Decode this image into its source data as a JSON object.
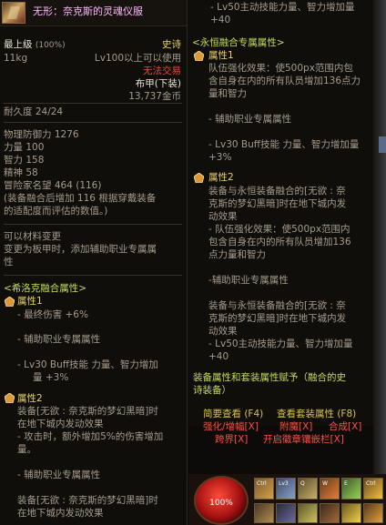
{
  "tooltip": {
    "name": "无形：奈克斯的灵魂仪服",
    "level_label": "最上级",
    "level_pct": "(100%)",
    "rarity": "史诗",
    "weight": "11kg",
    "level_req": "Lv100以上可以使用",
    "trade": "无法交易",
    "type": "布甲(下装)",
    "price": "13,737金币",
    "durability": "耐久度 24/24",
    "stats": [
      "物理防御力 1276",
      "力量 100",
      "智力 158",
      "精神 58",
      "冒险家名望 464 (116)",
      "(装备融合后增加 116 根据穿戴装备",
      "的适配度而评估的数值。)"
    ],
    "transfer": "可以材料变更",
    "transfer_desc": [
      "变更为板甲时，添加辅助职业专属属",
      "性"
    ],
    "fusion_title": "<希洛克融合属性>",
    "attr1_label": "属性1",
    "attr1_lines": [
      "- 最终伤害 +6%",
      "- 辅助职业专属属性",
      "- Lv30 Buff技能 力量、智力增加",
      "量 +3%"
    ],
    "attr2_label": "属性2",
    "attr2_lines": [
      "装备[无欲 : 奈克斯的梦幻黑暗]时",
      "在地下城内发动效果",
      "- 攻击时，额外增加5%的伤害增加",
      "量。",
      "- 辅助职业专属属性",
      "装备[无欲 : 奈克斯的梦幻黑暗]时",
      "在地下城内发动效果"
    ]
  },
  "tooltip_right": {
    "top_lines": [
      "- Lv50主动技能力量、智力增加量",
      "+40"
    ],
    "eternal_title": "<永恒融合专属属性>",
    "attr1_label": "属性1",
    "attr1_lines": [
      "队伍强化效果：使500px范围内包",
      "含自身在内的所有队员增加136点力",
      "量和智力",
      "- 辅助职业专属属性",
      "- Lv30 Buff技能 力量、智力增加量",
      "+3%"
    ],
    "attr2_label": "属性2",
    "attr2_lines": [
      "装备与永恒装备融合的[无欲 : 奈",
      "克斯的梦幻黑暗]时在地下城内发",
      "动效果",
      "- 队伍强化效果：使500px范围内",
      "包含自身在内的所有队员增加136",
      "点力量和智力",
      "-辅助职业专属属性",
      "装备与永恒装备融合的[无欲 : 奈",
      "克斯的梦幻黑暗]时在地下城内发",
      "动效果",
      "- Lv50主动技能力量、智力增加量",
      "+40"
    ],
    "set_note": [
      "装备属性和套装属性赋予（融合的史",
      "诗装备）"
    ]
  },
  "actions": {
    "brief": "简要查看 (F4)",
    "set_view": "查看套装属性 (F8)",
    "enhance": "强化/增幅[X]",
    "enchant": "附魔[X]",
    "synth": "合成[X]",
    "cross": "跨界[X]",
    "seal": "开启徽章镶嵌栏[X]"
  },
  "hud": {
    "hp": "100%",
    "slot_labels": [
      "Ctrl",
      "Lv3",
      "Q",
      "W",
      "E",
      "Ctrl"
    ]
  }
}
